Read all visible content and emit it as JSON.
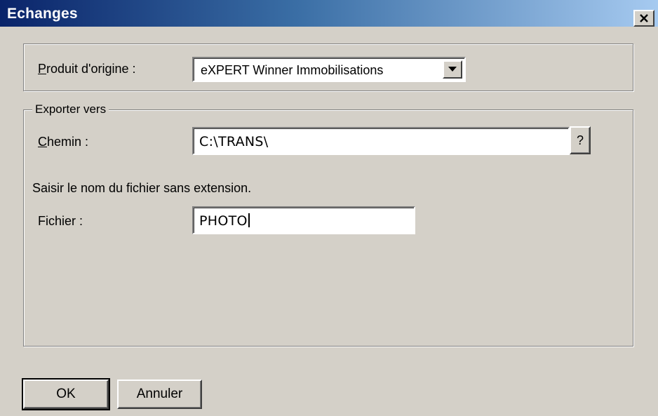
{
  "window": {
    "title": "Echanges",
    "close_label": "Close"
  },
  "source": {
    "label_accel": "P",
    "label_rest": "roduit d'origine :",
    "selected": "eXPERT Winner Immobilisations"
  },
  "export": {
    "legend": "Exporter vers",
    "path_label_accel": "C",
    "path_label_rest": "hemin :",
    "path_value": "C:\\TRANS\\",
    "browse_label": "?",
    "hint": "Saisir le nom du fichier sans extension.",
    "file_label": "Fichier :",
    "file_value": "PHOTO"
  },
  "buttons": {
    "ok": "OK",
    "cancel": "Annuler"
  }
}
